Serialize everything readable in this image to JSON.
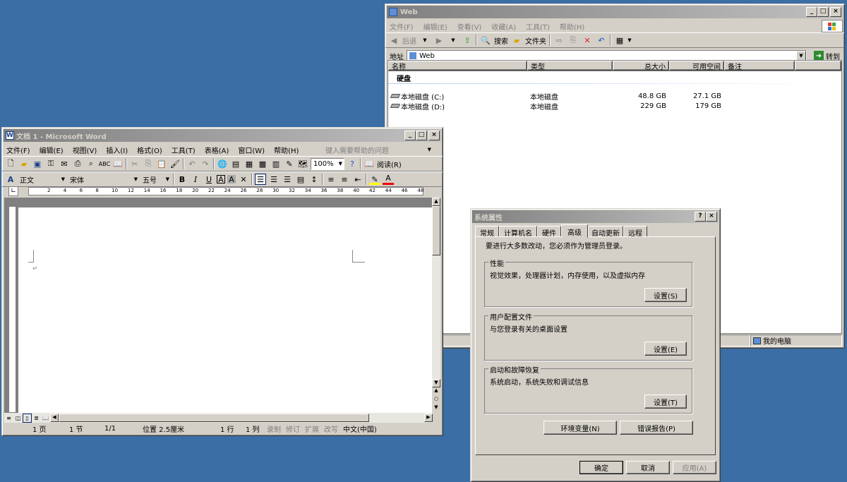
{
  "explorer": {
    "title": "Web",
    "menu": [
      "文件(F)",
      "编辑(E)",
      "查看(V)",
      "收藏(A)",
      "工具(T)",
      "帮助(H)"
    ],
    "toolbar": {
      "back": "后退",
      "search": "搜索",
      "folders": "文件夹"
    },
    "address_label": "地址",
    "address_value": "Web",
    "go_label": "转到",
    "columns": [
      "名称",
      "类型",
      "总大小",
      "可用空间",
      "备注"
    ],
    "group_header": "硬盘",
    "drives": [
      {
        "name": "本地磁盘 (C:)",
        "type": "本地磁盘",
        "total": "48.8 GB",
        "free": "27.1 GB"
      },
      {
        "name": "本地磁盘 (D:)",
        "type": "本地磁盘",
        "total": "229 GB",
        "free": "179 GB"
      }
    ],
    "status_location": "我的电脑"
  },
  "word": {
    "title": "文档 1 - Microsoft Word",
    "menu": [
      "文件(F)",
      "编辑(E)",
      "视图(V)",
      "插入(I)",
      "格式(O)",
      "工具(T)",
      "表格(A)",
      "窗口(W)",
      "帮助(H)"
    ],
    "help_placeholder": "键入需要帮助的问题",
    "zoom": "100%",
    "read_label": "阅读(R)",
    "style": "正文",
    "font": "宋体",
    "size": "五号",
    "ruler_ticks": [
      "2",
      "4",
      "6",
      "8",
      "10",
      "12",
      "14",
      "16",
      "18",
      "20",
      "22",
      "24",
      "26",
      "28",
      "30",
      "32",
      "34",
      "36",
      "38",
      "40",
      "42",
      "44",
      "46",
      "48"
    ],
    "paragraph_mark": "↵",
    "status": [
      "1 页",
      "1 节",
      "1/1",
      "位置 2.5厘米",
      "1 行",
      "1 列",
      "录制",
      "修订",
      "扩展",
      "改写",
      "中文(中国)"
    ]
  },
  "sysprops": {
    "title": "系统属性",
    "tabs": [
      "常规",
      "计算机名",
      "硬件",
      "高级",
      "自动更新",
      "远程"
    ],
    "active_tab": "高级",
    "intro": "要进行大多数改动，您必须作为管理员登录。",
    "groups": [
      {
        "label": "性能",
        "desc": "视觉效果，处理器计划，内存使用，以及虚拟内存",
        "button": "设置(S)"
      },
      {
        "label": "用户配置文件",
        "desc": "与您登录有关的桌面设置",
        "button": "设置(E)"
      },
      {
        "label": "启动和故障恢复",
        "desc": "系统启动，系统失败和调试信息",
        "button": "设置(T)"
      }
    ],
    "env_button": "环境变量(N)",
    "error_button": "错误报告(P)",
    "ok": "确定",
    "cancel": "取消",
    "apply": "应用(A)"
  }
}
